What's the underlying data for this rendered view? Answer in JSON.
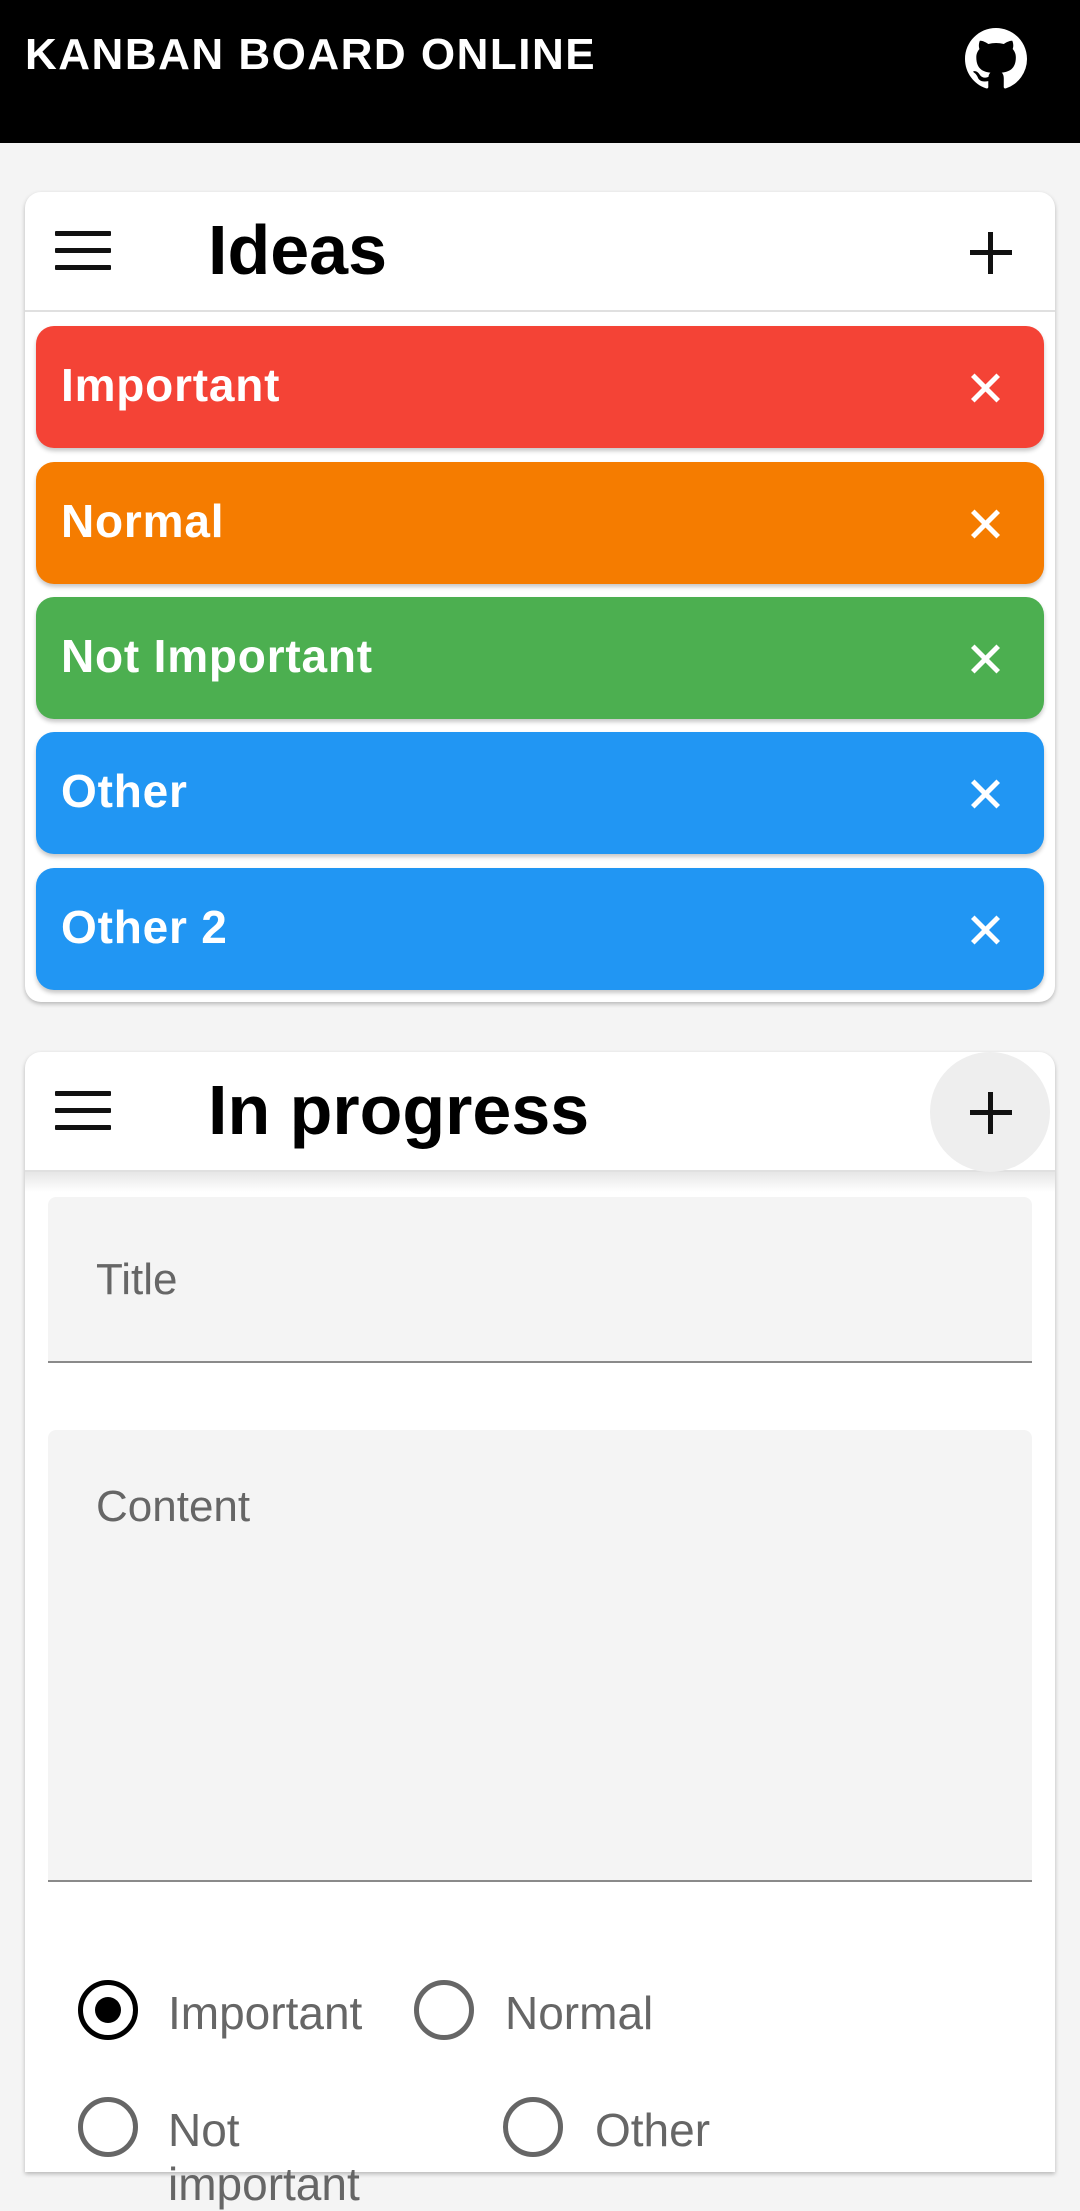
{
  "appbar": {
    "title": "KANBAN BOARD ONLINE"
  },
  "columns": {
    "ideas": {
      "title": "Ideas",
      "cards": [
        {
          "label": "Important",
          "color": "#f44336"
        },
        {
          "label": "Normal",
          "color": "#f57c00"
        },
        {
          "label": "Not Important",
          "color": "#4caf50"
        },
        {
          "label": "Other",
          "color": "#2196f3"
        },
        {
          "label": "Other 2",
          "color": "#2196f3"
        }
      ]
    },
    "in_progress": {
      "title": "In progress",
      "form": {
        "title_placeholder": "Title",
        "content_placeholder": "Content",
        "priority_options": [
          {
            "label": "Important",
            "checked": true
          },
          {
            "label": "Normal",
            "checked": false
          },
          {
            "label": "Not important",
            "checked": false
          },
          {
            "label": "Other",
            "checked": false
          }
        ]
      }
    }
  },
  "icons": {
    "appbar": "github-icon",
    "column_menu": "menu-icon",
    "column_add": "plus-icon",
    "card_close": "close-icon"
  },
  "colors": {
    "appbar_bg": "#000000",
    "page_bg": "#f4f4f4",
    "important": "#f44336",
    "normal": "#f57c00",
    "not_important": "#4caf50",
    "other": "#2196f3"
  }
}
